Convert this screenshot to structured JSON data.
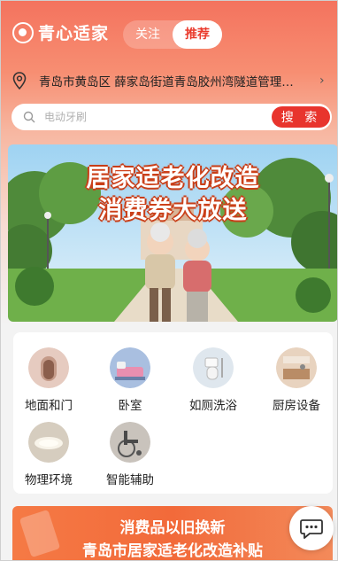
{
  "app": {
    "logo_text": "青心适家"
  },
  "tabs": {
    "follow": "关注",
    "recommend": "推荐"
  },
  "location": {
    "text": "青岛市黄岛区 薛家岛街道青岛胶州湾隧道管理…",
    "arrow": "›"
  },
  "search": {
    "placeholder": "电动牙刷",
    "button": "搜 索"
  },
  "banner": {
    "line1": "居家适老化改造",
    "line2": "消费券大放送"
  },
  "categories": [
    {
      "label": "地面和门",
      "icon": "floor-door-icon"
    },
    {
      "label": "卧室",
      "icon": "bedroom-icon"
    },
    {
      "label": "如厕洗浴",
      "icon": "bathroom-icon"
    },
    {
      "label": "厨房设备",
      "icon": "kitchen-icon"
    },
    {
      "label": "物理环境",
      "icon": "lamp-icon"
    },
    {
      "label": "智能辅助",
      "icon": "wheelchair-icon"
    }
  ],
  "promo": {
    "line1": "消费品以旧换新",
    "line2": "青岛市居家适老化改造补贴"
  },
  "colors": {
    "accent": "#e8342d",
    "header": "#f4735e"
  }
}
